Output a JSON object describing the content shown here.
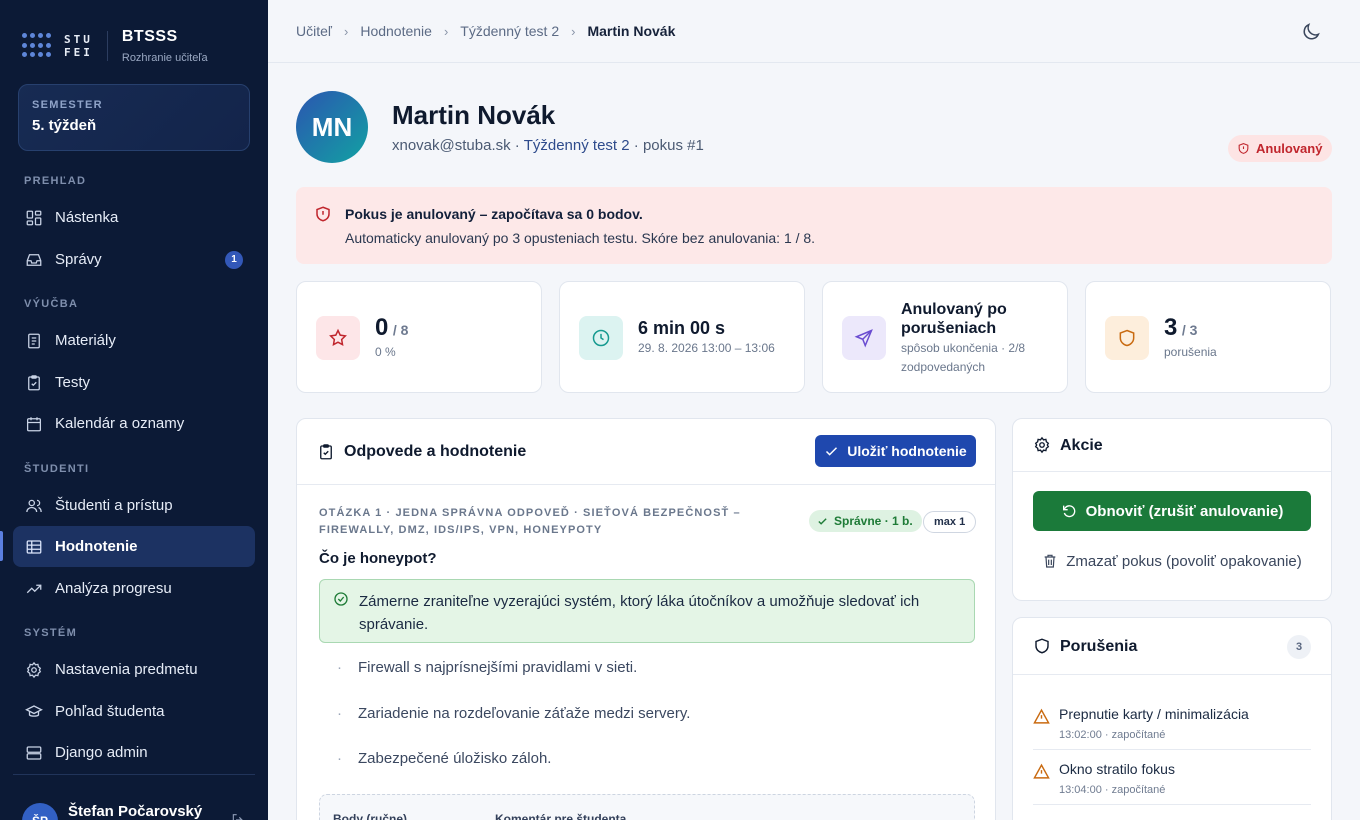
{
  "brand": {
    "logo_top": "STU",
    "logo_bottom": "FEI",
    "title": "BTSSS",
    "subtitle": "Rozhranie učiteľa"
  },
  "semester": {
    "label": "SEMESTER",
    "value": "5. týždeň"
  },
  "nav": {
    "sections": [
      "PREHĽAD",
      "VÝUČBA",
      "ŠTUDENTI",
      "SYSTÉM"
    ],
    "items": [
      {
        "label": "Nástenka",
        "icon": "dashboard-icon"
      },
      {
        "label": "Správy",
        "icon": "inbox-icon",
        "badge": "1"
      },
      {
        "label": "Materiály",
        "icon": "document-icon"
      },
      {
        "label": "Testy",
        "icon": "clipboard-check-icon"
      },
      {
        "label": "Kalendár a oznamy",
        "icon": "calendar-icon"
      },
      {
        "label": "Študenti a prístup",
        "icon": "users-icon"
      },
      {
        "label": "Hodnotenie",
        "icon": "table-icon",
        "active": true
      },
      {
        "label": "Analýza progresu",
        "icon": "trending-up-icon"
      },
      {
        "label": "Nastavenia predmetu",
        "icon": "gear-icon"
      },
      {
        "label": "Pohľad študenta",
        "icon": "graduation-cap-icon"
      },
      {
        "label": "Django admin",
        "icon": "server-icon"
      }
    ]
  },
  "user": {
    "initials": "ŠP",
    "name": "Štefan Počarovský"
  },
  "breadcrumb": [
    "Učiteľ",
    "Hodnotenie",
    "Týždenný test 2",
    "Martin Novák"
  ],
  "student": {
    "initials": "MN",
    "name": "Martin Novák",
    "email": "xnovak@stuba.sk",
    "test": "Týždenný test 2",
    "attempt": "pokus #1",
    "status": "Anulovaný"
  },
  "alert": {
    "title": "Pokus je anulovaný – započítava sa 0 bodov.",
    "text": "Automaticky anulovaný po 3 opusteniach testu. Skóre bez anulovania: 1 / 8."
  },
  "stats": {
    "score": {
      "value": "0",
      "max": "/ 8",
      "sub": "0 %"
    },
    "time": {
      "value": "6 min 00 s",
      "sub": "29. 8. 2026 13:00 – 13:06"
    },
    "finish": {
      "value": "Anulovaný po porušeniach",
      "sub": "spôsob ukončenia · 2/8 zodpovedaných"
    },
    "violations": {
      "value": "3",
      "max": "/ 3",
      "sub": "porušenia"
    }
  },
  "answers": {
    "title": "Odpovede a hodnotenie",
    "save_label": "Uložiť hodnotenie",
    "question": {
      "header": "OTÁZKA 1 · JEDNA SPRÁVNA ODPOVEĎ · SIEŤOVÁ BEZPEČNOSŤ – FIREWALLY, DMZ, IDS/IPS, VPN, HONEYPOTY",
      "result": "Správne · 1 b.",
      "max": "max 1",
      "text": "Čo je honeypot?",
      "correct_option": "Zámerne zraniteľne vyzerajúci systém, ktorý láka útočníkov a umožňuje sledovať ich správanie.",
      "options": [
        "Firewall s najprísnejšími pravidlami v sieti.",
        "Zariadenie na rozdeľovanie záťaže medzi servery.",
        "Zabezpečené úložisko záloh."
      ],
      "points_label": "Body (ručne)",
      "comment_label": "Komentár pre študenta"
    }
  },
  "actions": {
    "title": "Akcie",
    "restore_label": "Obnoviť (zrušiť anulovanie)",
    "delete_label": "Zmazať pokus (povoliť opakovanie)"
  },
  "violations": {
    "title": "Porušenia",
    "count": "3",
    "items": [
      {
        "label": "Prepnutie karty / minimalizácia",
        "meta": "13:02:00 · započítané"
      },
      {
        "label": "Okno stratilo fokus",
        "meta": "13:04:00 · započítané"
      }
    ]
  },
  "colors": {
    "sidebar_bg": "#0c1a36",
    "primary": "#1f48ae",
    "success": "#1b7a3a",
    "danger": "#c0262d",
    "warning": "#c96a10"
  }
}
